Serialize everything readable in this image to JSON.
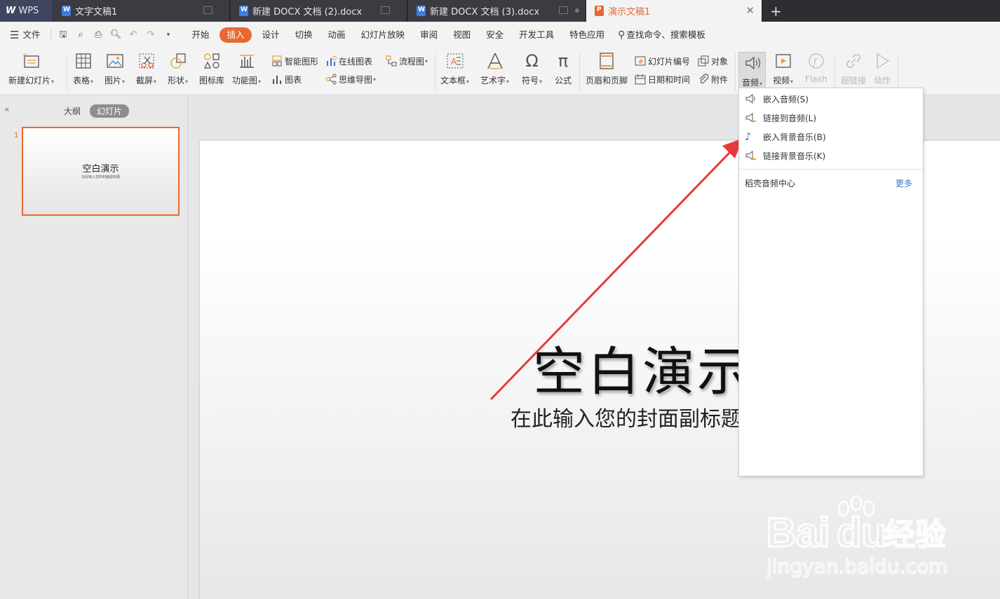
{
  "tabs": {
    "app": "WPS",
    "items": [
      {
        "label": "文字文稿1"
      },
      {
        "label": "新建 DOCX 文档 (2).docx"
      },
      {
        "label": "新建 DOCX 文档 (3).docx"
      },
      {
        "label": "演示文稿1"
      }
    ],
    "new_tab": "+"
  },
  "menu": {
    "file": "文件",
    "items": [
      "开始",
      "插入",
      "设计",
      "切换",
      "动画",
      "幻灯片放映",
      "审阅",
      "视图",
      "安全",
      "开发工具",
      "特色应用"
    ],
    "search": "查找命令、搜索模板"
  },
  "ribbon": {
    "new_slide": "新建幻灯片",
    "table": "表格",
    "picture": "图片",
    "screenshot": "截屏",
    "shape": "形状",
    "icon_lib": "图标库",
    "function_chart": "功能图",
    "smart_art": "智能图形",
    "chart": "图表",
    "online_chart": "在线图表",
    "mind_map": "思维导图",
    "flowchart": "流程图",
    "textbox": "文本框",
    "wordart": "艺术字",
    "symbol": "符号",
    "formula": "公式",
    "header_footer": "页眉和页脚",
    "slide_number": "幻灯片编号",
    "date_time": "日期和时间",
    "object": "对象",
    "attachment": "附件",
    "audio": "音频",
    "video": "视频",
    "flash": "Flash",
    "hyperlink": "超链接",
    "action": "动作"
  },
  "leftpane": {
    "outline_tab": "大纲",
    "slides_tab": "幻灯片",
    "slide_number": "1",
    "thumb_title": "空白演示",
    "thumb_subtitle": "在此输入您的封面副标题"
  },
  "slide": {
    "title": "空白演示",
    "subtitle": "在此输入您的封面副标题"
  },
  "audio_menu": {
    "items": [
      {
        "label": "嵌入音频(S)"
      },
      {
        "label": "链接到音频(L)"
      },
      {
        "label": "嵌入背景音乐(B)"
      },
      {
        "label": "链接背景音乐(K)"
      }
    ],
    "center_label": "稻壳音频中心",
    "more": "更多"
  },
  "watermark": {
    "brand": "Baidu",
    "cn": "经验",
    "url": "jingyan.baidu.com"
  },
  "colors": {
    "accent": "#e8682f",
    "tabbar": "#2d2d33",
    "arrow": "#e8393a",
    "link_blue": "#3a78c9"
  }
}
